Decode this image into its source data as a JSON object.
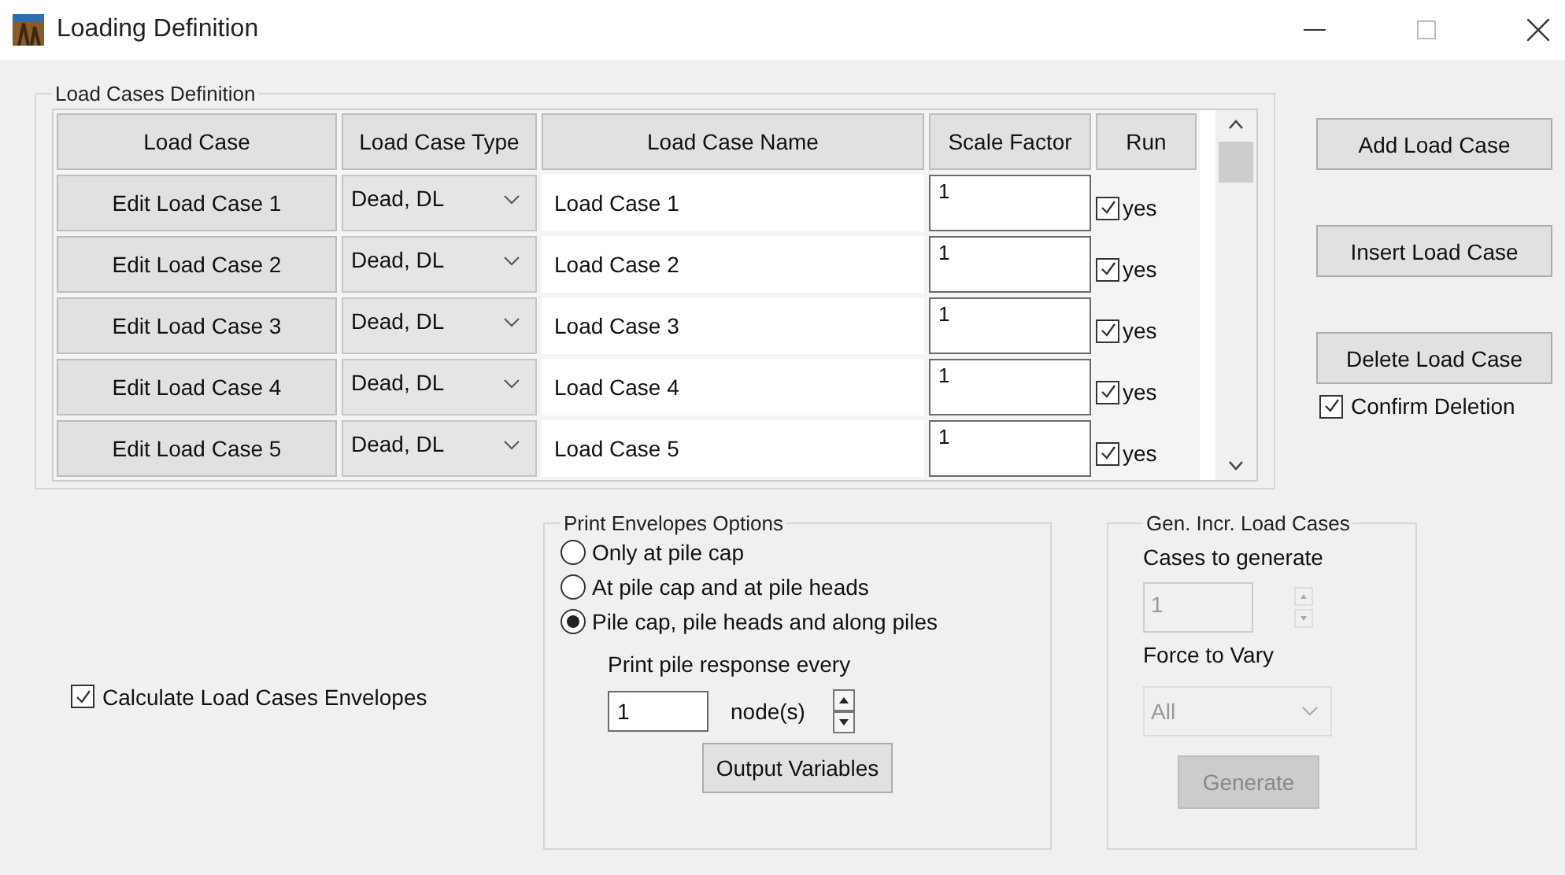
{
  "window": {
    "title": "Loading Definition"
  },
  "load_cases": {
    "title": "Load Cases Definition",
    "columns": [
      "Load Case",
      "Load Case Type",
      "Load Case Name",
      "Scale Factor",
      "Run"
    ],
    "rows": [
      {
        "edit_button": "Edit Load Case 1",
        "type": "Dead, DL",
        "name": "Load Case 1",
        "scale_factor": "1",
        "run": true,
        "run_label": "yes"
      },
      {
        "edit_button": "Edit Load Case 2",
        "type": "Dead, DL",
        "name": "Load Case 2",
        "scale_factor": "1",
        "run": true,
        "run_label": "yes"
      },
      {
        "edit_button": "Edit Load Case 3",
        "type": "Dead, DL",
        "name": "Load Case 3",
        "scale_factor": "1",
        "run": true,
        "run_label": "yes"
      },
      {
        "edit_button": "Edit Load Case 4",
        "type": "Dead, DL",
        "name": "Load Case 4",
        "scale_factor": "1",
        "run": true,
        "run_label": "yes"
      },
      {
        "edit_button": "Edit Load Case 5",
        "type": "Dead, DL",
        "name": "Load Case 5",
        "scale_factor": "1",
        "run": true,
        "run_label": "yes"
      }
    ]
  },
  "side_buttons": [
    "Add Load Case",
    "Insert Load Case",
    "Delete Load Case"
  ],
  "confirm_deletion": {
    "label": "Confirm Deletion",
    "checked": true
  },
  "calculate_envelopes": {
    "label": "Calculate Load Cases Envelopes",
    "checked": true
  },
  "print_envelopes": {
    "title": "Print Envelopes Options",
    "options": [
      {
        "label": "Only at pile cap",
        "selected": false
      },
      {
        "label": "At pile cap and at pile heads",
        "selected": false
      },
      {
        "label": "Pile cap, pile heads and along piles",
        "selected": true
      }
    ],
    "response_label": "Print pile response every",
    "response_value": "1",
    "unit": "node(s)",
    "button": "Output Variables"
  },
  "gen_incr": {
    "title": "Gen. Incr. Load Cases",
    "disabled": true,
    "cases_label": "Cases to generate",
    "cases_value": "1",
    "force_label": "Force to Vary",
    "force_value": "All",
    "button": "Generate"
  }
}
